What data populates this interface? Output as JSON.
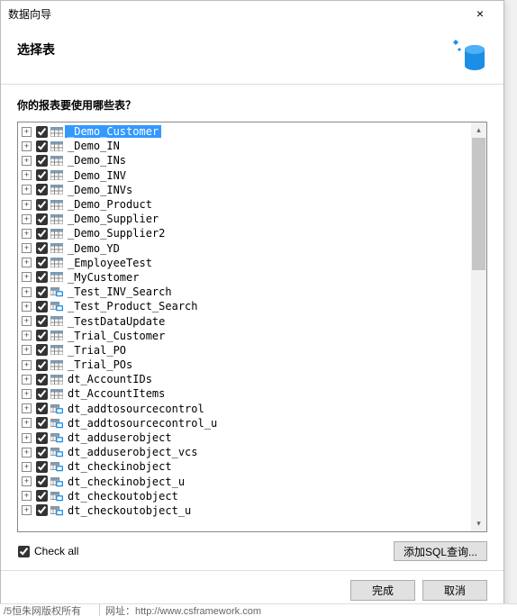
{
  "titlebar": {
    "title": "数据向导",
    "close": "×"
  },
  "header": {
    "title": "选择表"
  },
  "body": {
    "prompt": "你的报表要使用哪些表？",
    "check_all_label": "Check all",
    "check_all_checked": true,
    "add_sql_label": "添加SQL查询..."
  },
  "tables": [
    {
      "label": "_Demo_Customer",
      "checked": true,
      "icon": "table",
      "selected": true
    },
    {
      "label": "_Demo_IN",
      "checked": true,
      "icon": "table"
    },
    {
      "label": "_Demo_INs",
      "checked": true,
      "icon": "table"
    },
    {
      "label": "_Demo_INV",
      "checked": true,
      "icon": "table"
    },
    {
      "label": "_Demo_INVs",
      "checked": true,
      "icon": "table"
    },
    {
      "label": "_Demo_Product",
      "checked": true,
      "icon": "table"
    },
    {
      "label": "_Demo_Supplier",
      "checked": true,
      "icon": "table"
    },
    {
      "label": "_Demo_Supplier2",
      "checked": true,
      "icon": "table"
    },
    {
      "label": "_Demo_YD",
      "checked": true,
      "icon": "table"
    },
    {
      "label": "_EmployeeTest",
      "checked": true,
      "icon": "table"
    },
    {
      "label": "_MyCustomer",
      "checked": true,
      "icon": "table"
    },
    {
      "label": "_Test_INV_Search",
      "checked": true,
      "icon": "view"
    },
    {
      "label": "_Test_Product_Search",
      "checked": true,
      "icon": "view"
    },
    {
      "label": "_TestDataUpdate",
      "checked": true,
      "icon": "table"
    },
    {
      "label": "_Trial_Customer",
      "checked": true,
      "icon": "table"
    },
    {
      "label": "_Trial_PO",
      "checked": true,
      "icon": "table"
    },
    {
      "label": "_Trial_POs",
      "checked": true,
      "icon": "table"
    },
    {
      "label": "dt_AccountIDs",
      "checked": true,
      "icon": "table"
    },
    {
      "label": "dt_AccountItems",
      "checked": true,
      "icon": "table"
    },
    {
      "label": "dt_addtosourcecontrol",
      "checked": true,
      "icon": "view"
    },
    {
      "label": "dt_addtosourcecontrol_u",
      "checked": true,
      "icon": "view"
    },
    {
      "label": "dt_adduserobject",
      "checked": true,
      "icon": "view"
    },
    {
      "label": "dt_adduserobject_vcs",
      "checked": true,
      "icon": "view"
    },
    {
      "label": "dt_checkinobject",
      "checked": true,
      "icon": "view"
    },
    {
      "label": "dt_checkinobject_u",
      "checked": true,
      "icon": "view"
    },
    {
      "label": "dt_checkoutobject",
      "checked": true,
      "icon": "view"
    },
    {
      "label": "dt_checkoutobject_u",
      "checked": true,
      "icon": "view"
    }
  ],
  "footer": {
    "finish": "完成",
    "cancel": "取消"
  },
  "strip": {
    "left": "/5恒朱网版权所有",
    "right": "网址：http://www.csframework.com"
  },
  "colors": {
    "selection": "#3399ff",
    "view_icon": "#1b8ee6"
  }
}
